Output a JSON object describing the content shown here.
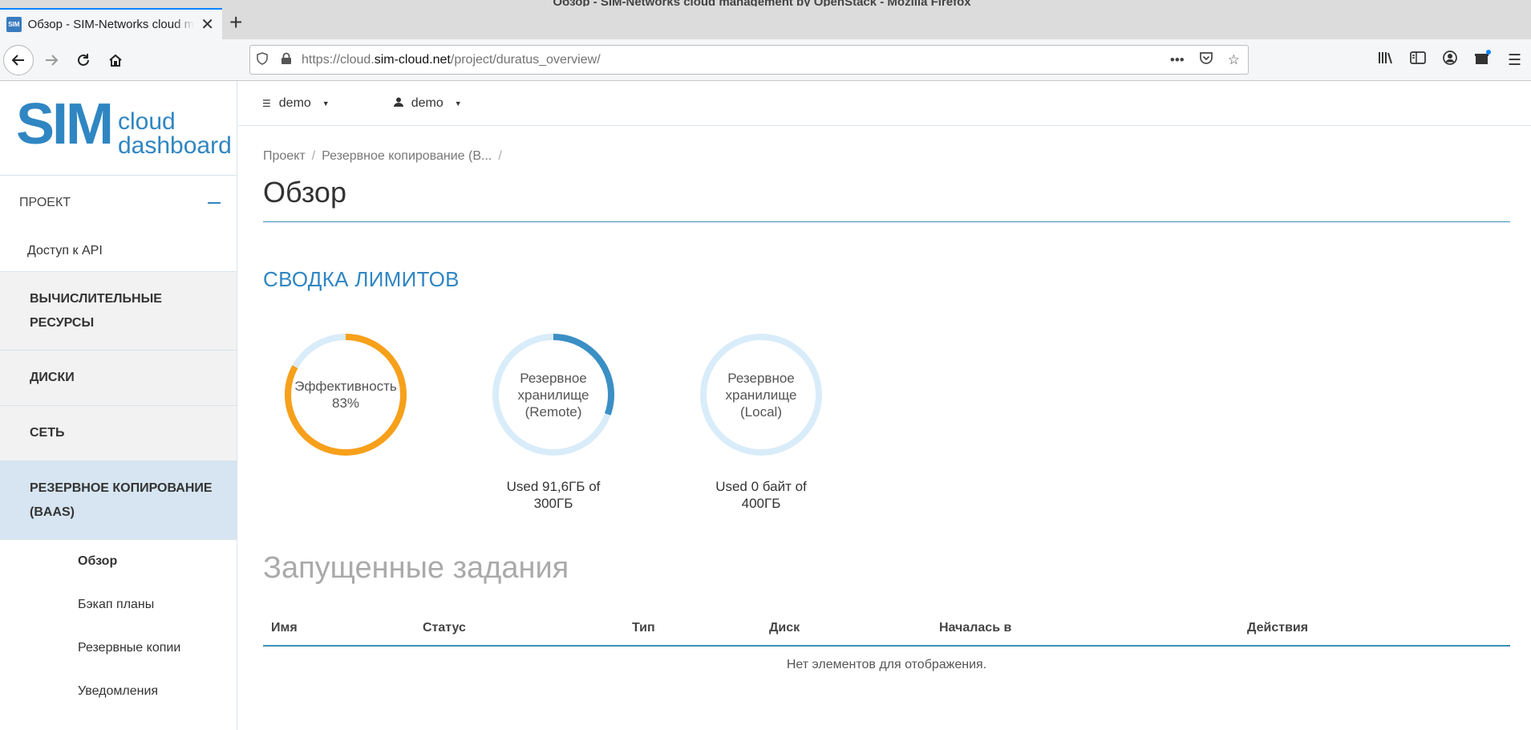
{
  "browser": {
    "window_title": "Обзор - SIM-Networks cloud management by OpenStack - Mozilla Firefox",
    "tab_title": "Обзор - SIM-Networks cloud m",
    "favicon_text": "SIM",
    "url_prefix": "https://cloud.",
    "url_host": "sim-cloud.net",
    "url_path": "/project/duratus_overview/"
  },
  "logo": {
    "sim": "SIM",
    "cloud": "cloud",
    "dashboard": "dashboard"
  },
  "sidebar": {
    "section": "ПРОЕКТ",
    "api_access": "Доступ к API",
    "groups": [
      {
        "label": "ВЫЧИСЛИТЕЛЬНЫЕ РЕСУРСЫ"
      },
      {
        "label": "ДИСКИ"
      },
      {
        "label": "СЕТЬ"
      },
      {
        "label": "РЕЗЕРВНОЕ КОПИРОВАНИЕ (BAAS)"
      }
    ],
    "sub_items": [
      {
        "label": "Обзор"
      },
      {
        "label": "Бэкап планы"
      },
      {
        "label": "Резервные копии"
      },
      {
        "label": "Уведомления"
      }
    ]
  },
  "topbar": {
    "project": "demo",
    "user": "demo"
  },
  "breadcrumb": {
    "item1": "Проект",
    "item2": "Резервное копирование (B..."
  },
  "page_title": "Обзор",
  "limits_title": "СВОДКА ЛИМИТОВ",
  "gauges": [
    {
      "label": "Эффективность 83%",
      "fraction": 0.83,
      "color": "#f7a01a",
      "used": ""
    },
    {
      "label": "Резервное хранилище (Remote)",
      "fraction": 0.305,
      "color": "#3a8fc4",
      "used": "Used 91,6ГБ of 300ГБ"
    },
    {
      "label": "Резервное хранилище (Local)",
      "fraction": 0,
      "color": "#3a8fc4",
      "used": "Used 0 байт of 400ГБ"
    }
  ],
  "jobs": {
    "title": "Запущенные задания",
    "columns": [
      "Имя",
      "Статус",
      "Тип",
      "Диск",
      "Началась в",
      "Действия"
    ],
    "empty": "Нет элементов для отображения."
  },
  "colors": {
    "accent": "#2f86c2",
    "track": "#d9ecf9",
    "efficiency": "#f7a01a"
  }
}
